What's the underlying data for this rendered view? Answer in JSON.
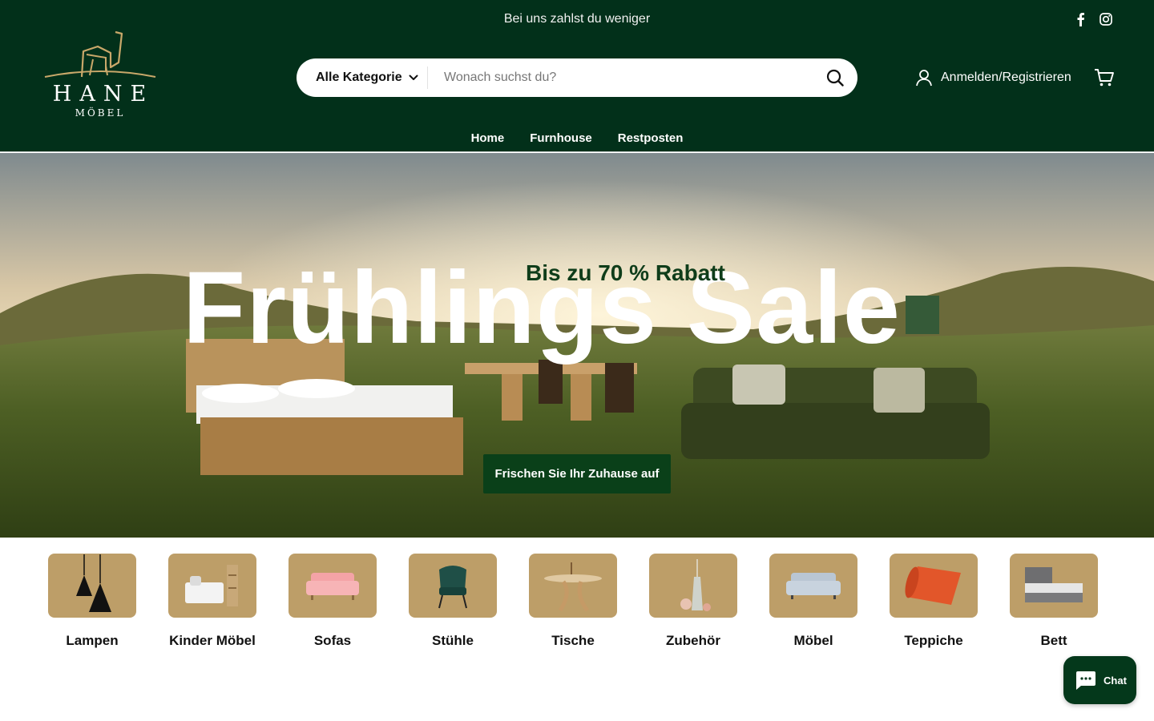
{
  "announcement": "Bei uns zahlst du weniger",
  "social": {
    "facebook_icon": "facebook-icon",
    "instagram_icon": "instagram-icon"
  },
  "logo": {
    "brand": "HANE",
    "sub": "MÖBEL"
  },
  "search": {
    "category_label": "Alle Kategorie",
    "placeholder": "Wonach suchst du?",
    "value": ""
  },
  "account": {
    "label": "Anmelden/Registrieren"
  },
  "nav": {
    "items": [
      "Home",
      "Furnhouse",
      "Restposten"
    ]
  },
  "hero": {
    "subtitle": "Bis zu 70 % Rabatt",
    "title": "Frühlings Sale",
    "cta": "Frischen Sie Ihr Zuhause auf"
  },
  "categories": [
    {
      "label": "Lampen"
    },
    {
      "label": "Kinder Möbel"
    },
    {
      "label": "Sofas"
    },
    {
      "label": "Stühle"
    },
    {
      "label": "Tische"
    },
    {
      "label": "Zubehör"
    },
    {
      "label": "Möbel"
    },
    {
      "label": "Teppiche"
    },
    {
      "label": "Bett"
    }
  ],
  "chat": {
    "label": "Chat"
  },
  "colors": {
    "header": "#02301a",
    "accent_tile": "#bd9e68",
    "cta": "#0a4019"
  }
}
